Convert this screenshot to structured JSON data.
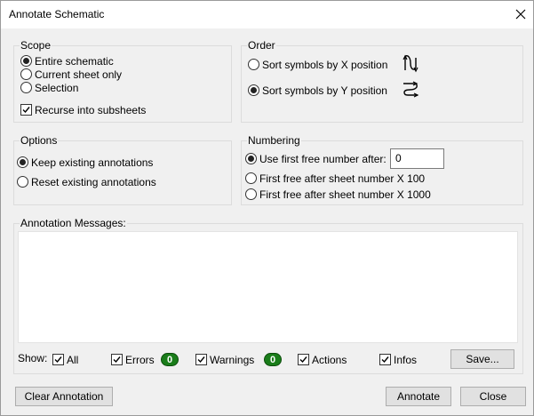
{
  "window": {
    "title": "Annotate Schematic"
  },
  "scope": {
    "title": "Scope",
    "options": [
      {
        "label": "Entire schematic",
        "selected": true
      },
      {
        "label": "Current sheet only",
        "selected": false
      },
      {
        "label": "Selection",
        "selected": false
      }
    ],
    "recurse": {
      "label": "Recurse into subsheets",
      "checked": true
    }
  },
  "order": {
    "title": "Order",
    "options": [
      {
        "label": "Sort symbols by X position",
        "selected": false,
        "icon": "sort-x-icon"
      },
      {
        "label": "Sort symbols by Y position",
        "selected": true,
        "icon": "sort-y-icon"
      }
    ]
  },
  "options": {
    "title": "Options",
    "items": [
      {
        "label": "Keep existing annotations",
        "selected": true
      },
      {
        "label": "Reset existing annotations",
        "selected": false
      }
    ]
  },
  "numbering": {
    "title": "Numbering",
    "items": [
      {
        "label": "Use first free number after:",
        "selected": true
      },
      {
        "label": "First free after sheet number X 100",
        "selected": false
      },
      {
        "label": "First free after sheet number X 1000",
        "selected": false
      }
    ],
    "first_free_value": "0"
  },
  "messages": {
    "title": "Annotation Messages:",
    "show_label": "Show:",
    "filters": {
      "all": {
        "label": "All",
        "checked": true
      },
      "errors": {
        "label": "Errors",
        "checked": true,
        "count": "0"
      },
      "warnings": {
        "label": "Warnings",
        "checked": true,
        "count": "0"
      },
      "actions": {
        "label": "Actions",
        "checked": true
      },
      "infos": {
        "label": "Infos",
        "checked": true
      }
    },
    "save_label": "Save..."
  },
  "footer": {
    "clear_label": "Clear Annotation",
    "annotate_label": "Annotate",
    "close_label": "Close"
  },
  "colors": {
    "badge_green": "#1a7d1a",
    "background": "#f0f0f0"
  }
}
